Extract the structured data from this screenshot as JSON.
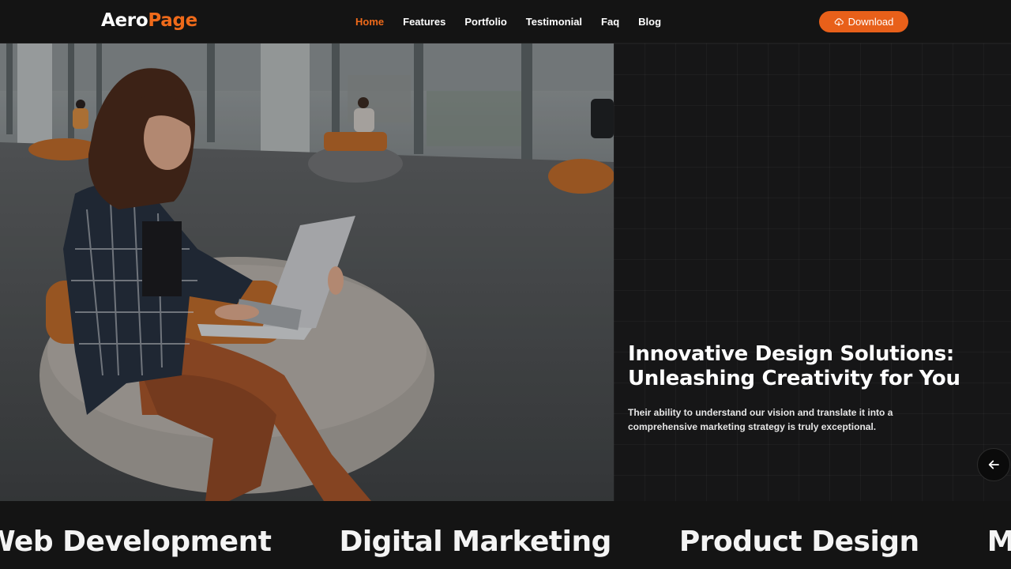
{
  "header": {
    "logo_part1": "Aero",
    "logo_part2": "Page",
    "nav": [
      "Home",
      "Features",
      "Portfolio",
      "Testimonial",
      "Faq",
      "Blog"
    ],
    "active_nav": "Home",
    "download_label": "Download",
    "download_icon": "download-cloud-icon"
  },
  "hero": {
    "title_line1": "Innovative Design Solutions:",
    "title_line2": "Unleashing Creativity for You",
    "description": "Their ability to understand our vision and translate it into a comprehensive marketing strategy is truly exceptional.",
    "prev_icon": "arrow-left-icon"
  },
  "marquee": {
    "items": [
      "Web Development",
      "Digital Marketing",
      "Product Design",
      "Mobile S"
    ]
  },
  "colors": {
    "accent": "#ef6a1a",
    "background": "#131313",
    "panel": "#161617"
  }
}
